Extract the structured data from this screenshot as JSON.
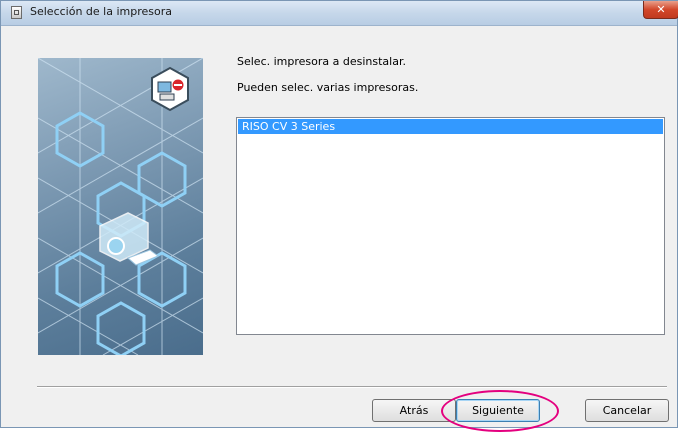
{
  "window": {
    "title": "Selección de la impresora",
    "close_label": "✕"
  },
  "main": {
    "instruction": "Selec. impresora a desinstalar.",
    "note": "Pueden selec. varias impresoras.",
    "printers": [
      {
        "label": "RISO CV 3 Series",
        "selected": true
      }
    ]
  },
  "buttons": {
    "back_label": "Atrás",
    "next_label": "Siguiente",
    "cancel_label": "Cancelar"
  },
  "colors": {
    "selection": "#3399ff",
    "highlight_ring": "#e4007f",
    "title_bar": "#c6d7ea"
  }
}
